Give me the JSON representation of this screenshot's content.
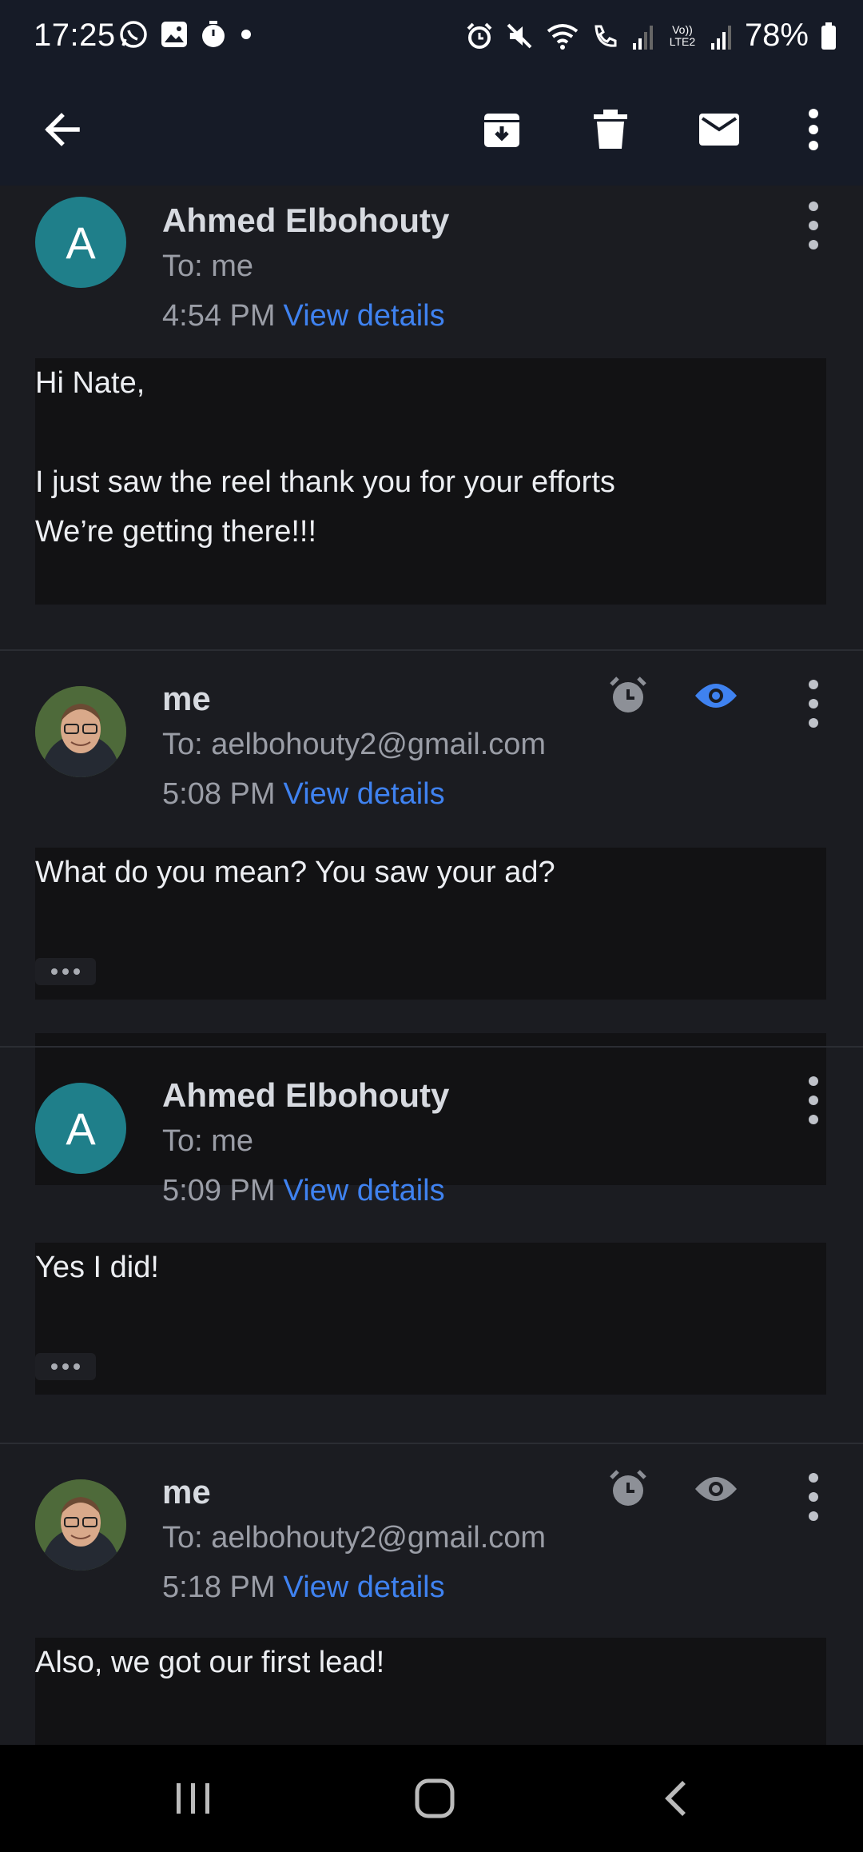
{
  "status_bar": {
    "time": "17:25",
    "battery": "78%",
    "left_icons": [
      "whatsapp-icon",
      "gallery-icon",
      "timer-icon",
      "dot-icon"
    ],
    "right_icons": [
      "alarm-icon",
      "mute-icon",
      "wifi-calling-icon",
      "signal-icon",
      "volte-icon",
      "signal-icon",
      "battery-icon"
    ],
    "volte_label": "Vo)) LTE2"
  },
  "app_bar": {
    "icons": [
      "back-arrow-icon",
      "archive-icon",
      "delete-icon",
      "mark-unread-icon",
      "more-vert-icon"
    ]
  },
  "messages": [
    {
      "avatar_letter": "A",
      "sender": "Ahmed Elbohouty",
      "recipient": "To: me",
      "time": "4:54 PM",
      "details_link": "View details",
      "body": "Hi Nate,\n\nI just saw the reel thank you for your efforts\nWe’re getting there!!!"
    },
    {
      "avatar": "photo",
      "sender": "me",
      "recipient": "To: aelbohouty2@gmail.com",
      "time": "5:08 PM",
      "details_link": "View details",
      "body": "What do you mean? You saw your ad?",
      "tracking_opened": true
    },
    {
      "avatar_letter": "A",
      "sender": "Ahmed Elbohouty",
      "recipient": "To: me",
      "time": "5:09 PM",
      "details_link": "View details",
      "body": "Yes I did!"
    },
    {
      "avatar": "photo",
      "sender": "me",
      "recipient": "To: aelbohouty2@gmail.com",
      "time": "5:18 PM",
      "details_link": "View details",
      "body": "Also, we got our first lead!",
      "tracking_opened": false
    }
  ],
  "nav_bar": {
    "icons": [
      "recents-icon",
      "home-icon",
      "back-icon"
    ]
  },
  "colors": {
    "accent": "#3f82f0",
    "avatar_teal": "#1f7f8a",
    "background": "#1b1c21",
    "bar": "#161b27"
  }
}
